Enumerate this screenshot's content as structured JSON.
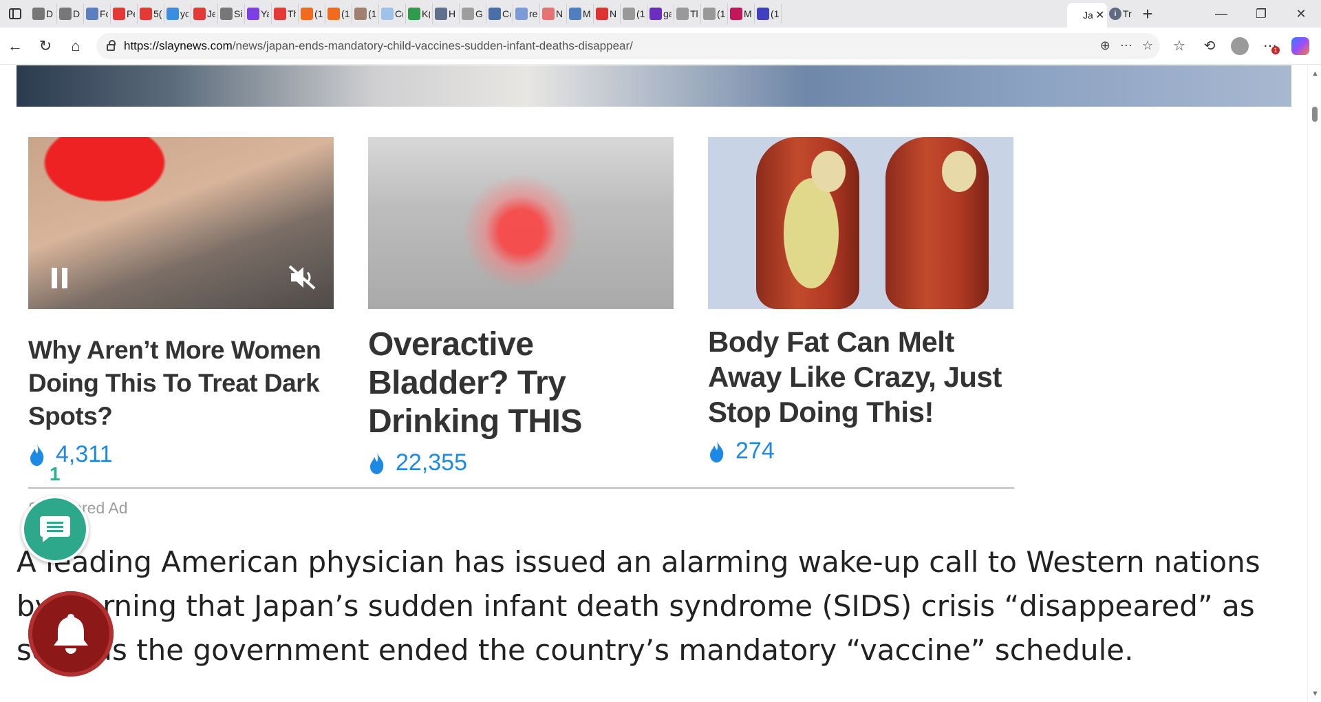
{
  "browser": {
    "tabs": [
      {
        "label": "D",
        "icon": "globe-icon",
        "color": "#777777"
      },
      {
        "label": "D",
        "icon": "globe-icon",
        "color": "#777777"
      },
      {
        "label": "Fc",
        "icon": "news-icon",
        "color": "#5b7fbf"
      },
      {
        "label": "Pe",
        "icon": "youtube-icon",
        "color": "#e53935"
      },
      {
        "label": "5(",
        "icon": "youtube-icon",
        "color": "#e53935"
      },
      {
        "label": "yc",
        "icon": "bing-icon",
        "color": "#3b8de0"
      },
      {
        "label": "Je",
        "icon": "youtube-icon",
        "color": "#e53935"
      },
      {
        "label": "Si",
        "icon": "globe-icon",
        "color": "#777777"
      },
      {
        "label": "Ya",
        "icon": "slash-icon",
        "color": "#7b3fe4"
      },
      {
        "label": "Th",
        "icon": "youtube-icon",
        "color": "#e53935"
      },
      {
        "label": "(1",
        "icon": "bookmark-icon",
        "color": "#f26b1d"
      },
      {
        "label": "(1",
        "icon": "bookmark-icon",
        "color": "#f26b1d"
      },
      {
        "label": "(1",
        "icon": "image-icon",
        "color": "#a08070"
      },
      {
        "label": "C(",
        "icon": "feather-icon",
        "color": "#9fc3e8"
      },
      {
        "label": "K(",
        "icon": "bar-icon",
        "color": "#2e9c4a"
      },
      {
        "label": "H",
        "icon": "photo-icon",
        "color": "#60708a"
      },
      {
        "label": "G",
        "icon": "google-icon",
        "color": "#9e9e9e"
      },
      {
        "label": "C(",
        "icon": "m-icon",
        "color": "#4a6ea8"
      },
      {
        "label": "re",
        "icon": "search-icon",
        "color": "#7b9bd8"
      },
      {
        "label": "N",
        "icon": "r-icon",
        "color": "#e57373"
      },
      {
        "label": "M",
        "icon": "circle-icon",
        "color": "#4f7fbf"
      },
      {
        "label": "N",
        "icon": "pdf-icon",
        "color": "#d33"
      },
      {
        "label": "(1",
        "icon": "otn-icon",
        "color": "#999999"
      },
      {
        "label": "ga",
        "icon": "yahoo-icon",
        "color": "#6b2fbf"
      },
      {
        "label": "Tl",
        "icon": "gp-icon",
        "color": "#999999"
      },
      {
        "label": "(1",
        "icon": "fp-icon",
        "color": "#999999"
      },
      {
        "label": "M",
        "icon": "lips-icon",
        "color": "#c2185b"
      },
      {
        "label": "(1",
        "icon": "mail-icon",
        "color": "#3f3fbf"
      }
    ],
    "active_tab": {
      "label": "Ja",
      "close": "✕"
    },
    "trailing_tab": {
      "label": "Tr",
      "icon": "circle-i-icon"
    },
    "new_tab": "+",
    "window_controls": {
      "minimize": "—",
      "maximize": "❐",
      "close": "✕"
    },
    "url": {
      "host": "https://slaynews.com",
      "path": "/news/japan-ends-mandatory-child-vaccines-sudden-infant-deaths-disappear/"
    },
    "notification_badge": "1"
  },
  "ads": [
    {
      "title": "Why Aren’t More Women Doing This To Treat Dark Spots?",
      "count": "4,311",
      "has_video_controls": true
    },
    {
      "title": "Overactive Bladder? Try Drinking THIS",
      "count": "22,355",
      "has_video_controls": false
    },
    {
      "title": "Body Fat Can Melt Away Like Crazy, Just Stop Doing This!",
      "count": "274",
      "has_video_controls": false
    }
  ],
  "sponsored_label": "Sponsored Ad",
  "chat": {
    "count": "1"
  },
  "article": {
    "paragraph": "A leading American physician has issued an alarming wake-up call to Western nations by warning that Japan’s sudden infant death syndrome (SIDS) crisis “disappeared” as soon as the government ended the country’s mandatory “vaccine” schedule."
  },
  "colors": {
    "accent_blue": "#1e88e5",
    "chat_green": "#2ea88b",
    "bell_red": "#8c1818"
  }
}
